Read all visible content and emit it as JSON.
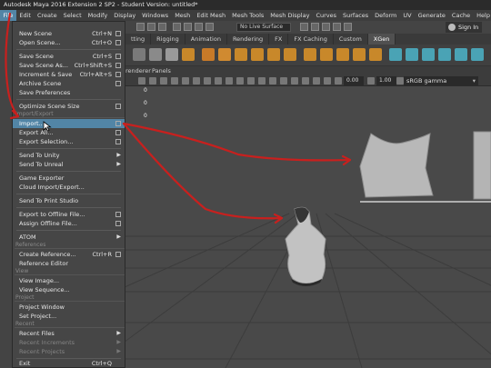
{
  "window": {
    "title": "Autodesk Maya 2016 Extension 2 SP2 - Student Version: untitled*"
  },
  "menubar": {
    "items": [
      "File",
      "Edit",
      "Create",
      "Select",
      "Modify",
      "Display",
      "Windows",
      "Mesh",
      "Edit Mesh",
      "Mesh Tools",
      "Mesh Display",
      "Curves",
      "Surfaces",
      "Deform",
      "UV",
      "Generate",
      "Cache",
      "Help"
    ]
  },
  "status_line": {
    "live_surface": "No Live Surface",
    "sign_in": "Sign In"
  },
  "shelf_tabs": [
    "tting",
    "Rigging",
    "Animation",
    "Rendering",
    "FX",
    "FX Caching",
    "Custom",
    "XGen"
  ],
  "viewport": {
    "menu": [
      "renderer",
      "Panels"
    ],
    "exposure": "0.00",
    "gamma_value": "1.00",
    "color_space": "sRGB gamma"
  },
  "file_menu": {
    "new_scene": "New Scene",
    "new_scene_sc": "Ctrl+N",
    "open_scene": "Open Scene...",
    "open_scene_sc": "Ctrl+O",
    "save_scene": "Save Scene",
    "save_scene_sc": "Ctrl+S",
    "save_scene_as": "Save Scene As...",
    "save_scene_as_sc": "Ctrl+Shift+S",
    "increment_save": "Increment & Save",
    "increment_save_sc": "Ctrl+Alt+S",
    "archive_scene": "Archive Scene",
    "save_preferences": "Save Preferences",
    "optimize_scene_size": "Optimize Scene Size",
    "section_import_export": "Import/Export",
    "import": "Import...",
    "export_all": "Export All...",
    "export_selection": "Export Selection...",
    "send_to_unity": "Send To Unity",
    "send_to_unreal": "Send To Unreal",
    "game_exporter": "Game Exporter",
    "cloud_import_export": "Cloud Import/Export...",
    "send_to_print_studio": "Send To Print Studio",
    "export_offline_file": "Export to Offline File...",
    "assign_offline_file": "Assign Offline File...",
    "atom": "ATOM",
    "section_references": "References",
    "create_reference": "Create Reference...",
    "create_reference_sc": "Ctrl+R",
    "reference_editor": "Reference Editor",
    "section_view": "View",
    "view_image": "View Image...",
    "view_sequence": "View Sequence...",
    "section_project": "Project",
    "project_window": "Project Window",
    "set_project": "Set Project...",
    "section_recent": "Recent",
    "recent_files": "Recent Files",
    "recent_increments": "Recent Increments",
    "recent_projects": "Recent Projects",
    "exit": "Exit",
    "exit_sc": "Ctrl+Q"
  },
  "colors": {
    "accent": "#5285a6",
    "annotation": "#c8201e",
    "mesh": "#b4b4b4"
  }
}
